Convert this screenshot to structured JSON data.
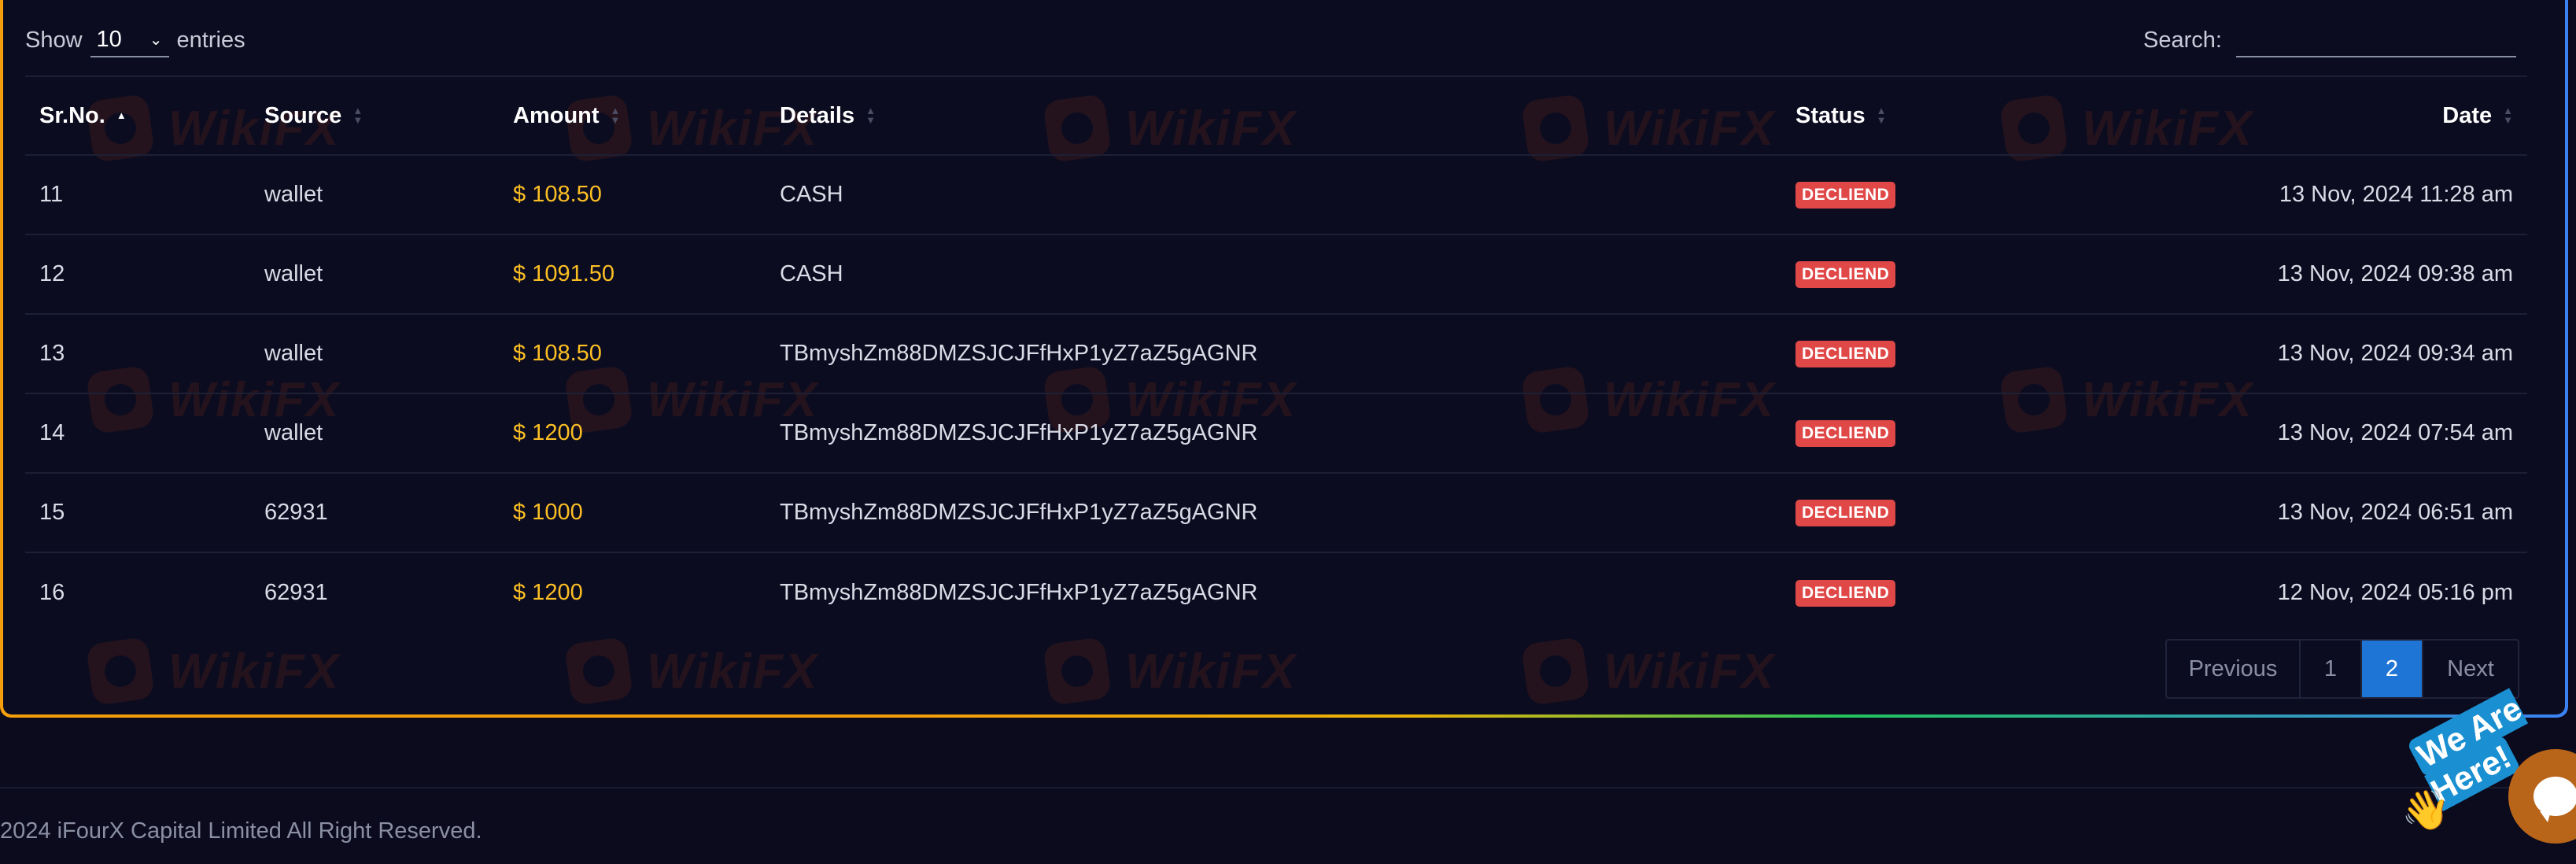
{
  "length_menu": {
    "show_label": "Show",
    "value": "10",
    "entries_label": "entries"
  },
  "search": {
    "label": "Search:",
    "value": ""
  },
  "table": {
    "columns": [
      "Sr.No.",
      "Source",
      "Amount",
      "Details",
      "Status",
      "Date"
    ],
    "rows": [
      {
        "sr": "11",
        "source": "wallet",
        "amount": "$ 108.50",
        "details": "CASH",
        "status": "DECLIEND",
        "date": "13 Nov, 2024 11:28 am"
      },
      {
        "sr": "12",
        "source": "wallet",
        "amount": "$ 1091.50",
        "details": "CASH",
        "status": "DECLIEND",
        "date": "13 Nov, 2024 09:38 am"
      },
      {
        "sr": "13",
        "source": "wallet",
        "amount": "$ 108.50",
        "details": "TBmyshZm88DMZSJCJFfHxP1yZ7aZ5gAGNR",
        "status": "DECLIEND",
        "date": "13 Nov, 2024 09:34 am"
      },
      {
        "sr": "14",
        "source": "wallet",
        "amount": "$ 1200",
        "details": "TBmyshZm88DMZSJCJFfHxP1yZ7aZ5gAGNR",
        "status": "DECLIEND",
        "date": "13 Nov, 2024 07:54 am"
      },
      {
        "sr": "15",
        "source": "62931",
        "amount": "$ 1000",
        "details": "TBmyshZm88DMZSJCJFfHxP1yZ7aZ5gAGNR",
        "status": "DECLIEND",
        "date": "13 Nov, 2024 06:51 am"
      },
      {
        "sr": "16",
        "source": "62931",
        "amount": "$ 1200",
        "details": "TBmyshZm88DMZSJCJFfHxP1yZ7aZ5gAGNR",
        "status": "DECLIEND",
        "date": "12 Nov, 2024 05:16 pm"
      }
    ]
  },
  "pagination": {
    "previous": "Previous",
    "pages": [
      "1",
      "2"
    ],
    "active": "2",
    "next": "Next"
  },
  "footer": {
    "copyright": "2024 iFourX Capital Limited All Right Reserved."
  },
  "chat_widget": {
    "label": "We Are Here!",
    "wave": "👋"
  },
  "watermark": {
    "text": "WikiFX"
  },
  "colors": {
    "accent": "#1f75d6",
    "amount": "#fbbf24",
    "declined": "#e04848"
  }
}
